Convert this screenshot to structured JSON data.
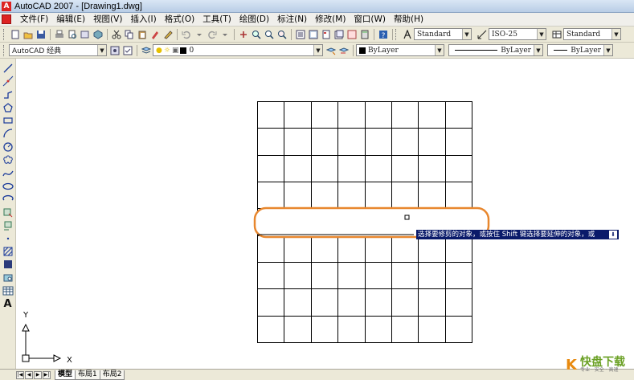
{
  "window": {
    "title": "AutoCAD 2007 - [Drawing1.dwg]"
  },
  "menu": {
    "items": [
      "文件(F)",
      "编辑(E)",
      "视图(V)",
      "插入(I)",
      "格式(O)",
      "工具(T)",
      "绘图(D)",
      "标注(N)",
      "修改(M)",
      "窗口(W)",
      "帮助(H)"
    ]
  },
  "toolbar1": {
    "text_style": "Standard",
    "dim_style": "ISO-25",
    "table_style": "Standard"
  },
  "toolbar2": {
    "workspace": "AutoCAD 经典",
    "layer": "0",
    "color": "ByLayer",
    "linetype": "ByLayer",
    "lineweight": "ByLayer"
  },
  "draw_toolbar": {
    "text_tool_glyph": "A"
  },
  "canvas": {
    "grid_columns": 8,
    "grid_rows": 9,
    "highlight_color": "#e8872e",
    "ucs_y_label": "Y",
    "ucs_x_label": "X"
  },
  "tooltip": {
    "text": "选择要修剪的对象，或按住 Shift 键选择要延伸的对象，或",
    "button_glyph": "⬇"
  },
  "tabs": {
    "nav": [
      "|◀",
      "◀",
      "▶",
      "▶|"
    ],
    "items": [
      "模型",
      "布局1",
      "布局2"
    ]
  },
  "watermark": {
    "logo": "K",
    "main": "快盘下载",
    "sub": "专业 · 安全 · 高速"
  }
}
